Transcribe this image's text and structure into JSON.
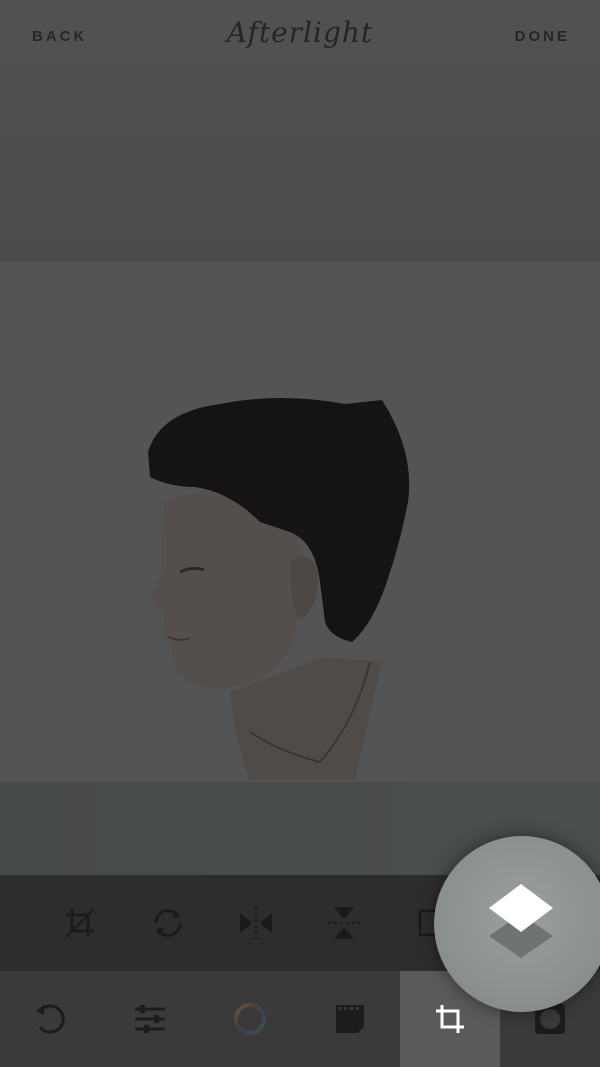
{
  "header": {
    "back_label": "BACK",
    "app_name": "Afterlight",
    "done_label": "DONE"
  },
  "tools": [
    {
      "name": "crop-straighten"
    },
    {
      "name": "rotate"
    },
    {
      "name": "flip-horizontal"
    },
    {
      "name": "flip-vertical"
    },
    {
      "name": "perspective"
    }
  ],
  "tabs": [
    {
      "name": "undo"
    },
    {
      "name": "adjustments"
    },
    {
      "name": "filters"
    },
    {
      "name": "film-effects"
    },
    {
      "name": "crop",
      "active": true
    },
    {
      "name": "frames"
    }
  ],
  "colors": {
    "accent": "#ffffff",
    "toolbar": "#2d2d2d",
    "tabbar": "#3a3a3a"
  }
}
